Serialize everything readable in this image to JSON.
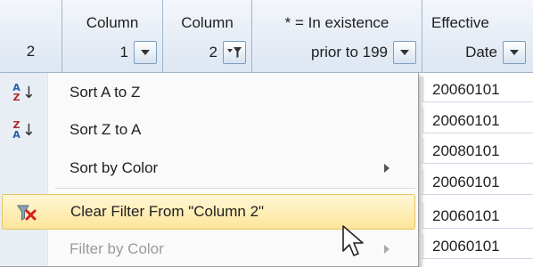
{
  "header": {
    "row_number": "2",
    "columns": [
      {
        "top": "Column",
        "bottom": "1"
      },
      {
        "top": "Column",
        "bottom": "2"
      },
      {
        "top": "* = In existence",
        "bottom": "prior to 199"
      },
      {
        "top": "Effective",
        "bottom": "Date"
      }
    ]
  },
  "cells": [
    "20060101",
    "20060101",
    "20080101",
    "20060101",
    "20060101",
    "20060101"
  ],
  "menu": {
    "items": [
      {
        "label": "Sort A to Z",
        "icon": "sort-ascending-icon"
      },
      {
        "label": "Sort Z to A",
        "icon": "sort-descending-icon"
      },
      {
        "label": "Sort by Color"
      },
      {
        "label": "Clear Filter From \"Column 2\"",
        "icon": "clear-filter-icon"
      },
      {
        "label": "Filter by Color"
      }
    ]
  },
  "colors": {
    "header_bg": "#dde6f2",
    "highlight": "#fde59a",
    "gutter": "#e9eef4"
  }
}
